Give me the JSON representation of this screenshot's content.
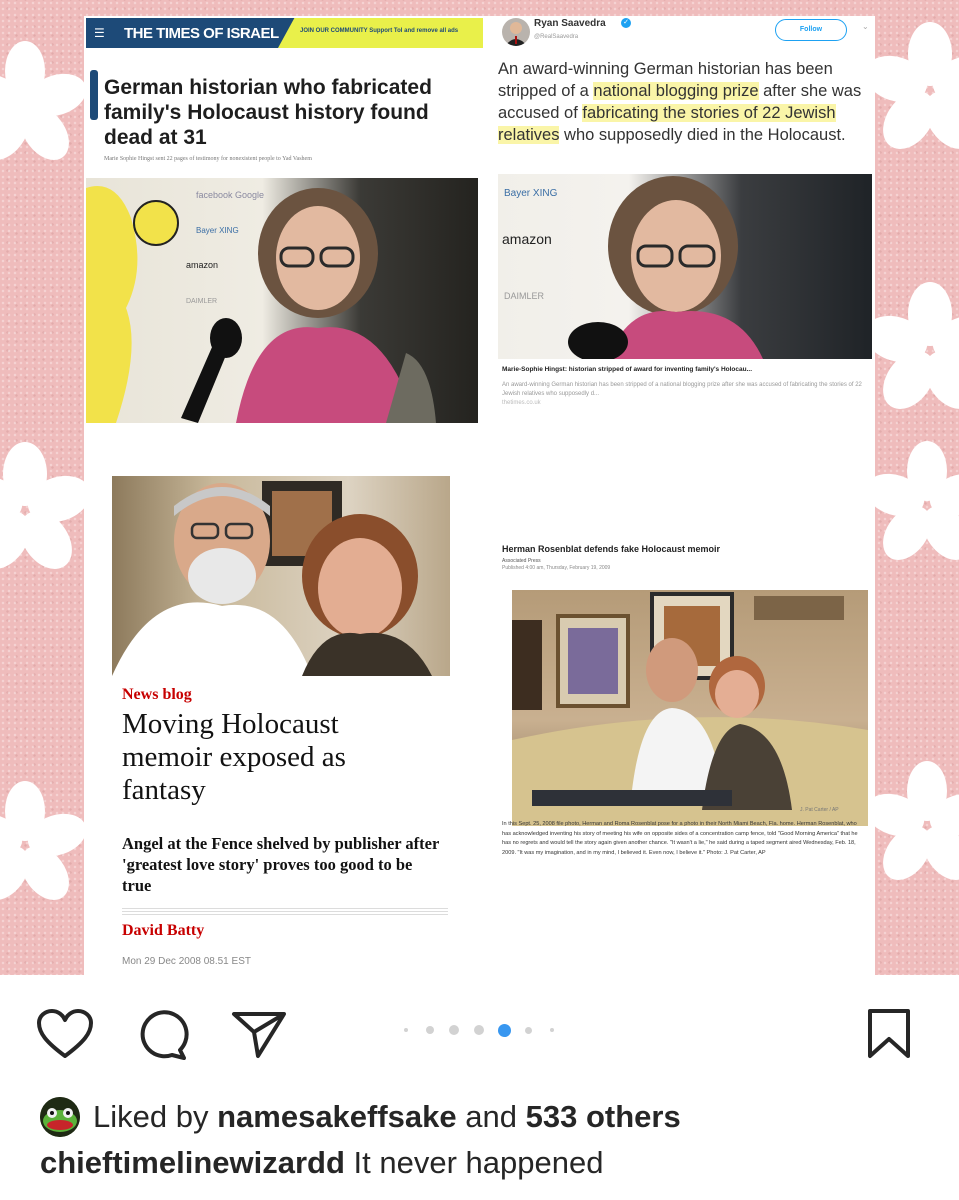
{
  "post": {
    "collage": {
      "times_of_israel": {
        "brand": "THE TIMES OF ISRAEL",
        "join_banner": "JOIN OUR COMMUNITY  Support ToI and remove all ads",
        "headline": "German historian who fabricated family's Holocaust history found dead at 31",
        "subhead": "Marie Sophie Hingst sent 22 pages of testimony for nonexistent people to Yad Vashem"
      },
      "tweet": {
        "author_name": "Ryan Saavedra",
        "author_handle": "@RealSaavedra",
        "follow_label": "Follow",
        "text_part1": "An award-winning German historian has been stripped of a ",
        "text_highlight1": "national blogging prize",
        "text_part2": " after she was accused of ",
        "text_highlight2": "fabricating the stories of 22 Jewish relatives",
        "text_part3": " who supposedly died in the Holocaust.",
        "card_title": "Marie-Sophie Hingst: historian stripped of award for inventing family's Holocau...",
        "card_description": "An award-winning German historian has been stripped of a national blogging prize after she was accused of fabricating the stories of 22 Jewish relatives who supposedly d...",
        "card_source": "thetimes.co.uk"
      },
      "guardian": {
        "kicker": "News blog",
        "headline": "Moving Holocaust memoir exposed as fantasy",
        "standfirst": "Angel at the Fence shelved by publisher after 'greatest love story' proves too good to be true",
        "author": "David Batty",
        "date": "Mon 29 Dec 2008 08.51 EST"
      },
      "ap_article": {
        "title": "Herman Rosenblat defends fake Holocaust memoir",
        "byline": "Associated Press",
        "published": "Published 4:00 am, Thursday, February 19, 2009",
        "photo_credit": "J. Pat Carter / AP",
        "caption": "In this Sept. 25, 2008 file photo, Herman and Roma Rosenblat pose for a photo in their North Miami Beach, Fla. home. Herman Rosenblat, who has acknowledged inventing his story of meeting his wife on opposite sides of a concentration camp fence, told \"Good Morning America\" that he has no regrets and would tell the story again given another chance. \"It wasn't a lie,\" he said during a taped segment aired Wednesday, Feb. 18, 2009. \"It was my imagination, and in my mind, I believed it. Even now, I believe it.\" Photo: J. Pat Carter, AP"
      }
    },
    "carousel": {
      "total": 7,
      "active_index": 4
    },
    "actions": {
      "like_icon": "heart-icon",
      "comment_icon": "comment-icon",
      "share_icon": "paper-plane-icon",
      "save_icon": "bookmark-icon"
    },
    "likes": {
      "prefix": "Liked by",
      "liker": "namesakeffsake",
      "connector": "and",
      "others": "533 others"
    },
    "caption": {
      "username": "chieftimelinewizardd",
      "text": "It never happened"
    },
    "colors": {
      "background_pink": "#efbcbc",
      "toi_blue": "#1d4a78",
      "guardian_red": "#c70000",
      "highlight_yellow": "#faf5a8",
      "carousel_active": "#3897f0"
    }
  }
}
